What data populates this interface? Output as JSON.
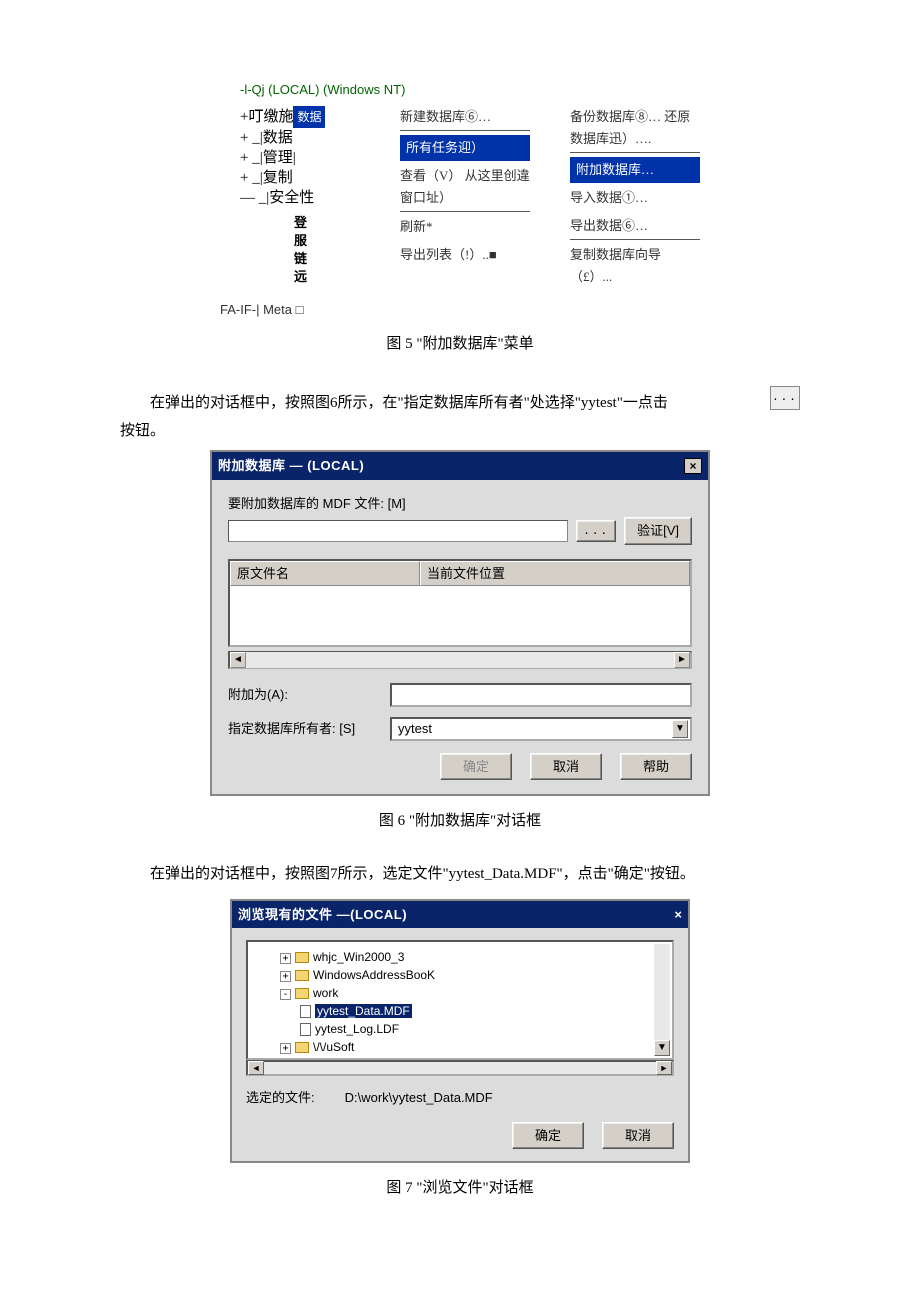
{
  "fig5": {
    "root": "-l-Qj (LOCAL) (Windows NT)",
    "tree": {
      "n1": "+叮缴施",
      "badge": "数据",
      "n2": "+ _|数据",
      "n3": "+ _|管理|",
      "n4": "+ _|复制",
      "n5": "— _|安全性",
      "i1": "登",
      "i2": "服",
      "i3": "链",
      "i4": "远"
    },
    "menu1": {
      "m1": "新建数据库⑥…",
      "m2": "所有任务迎）",
      "m3": "查看（V） 从这里创違窗口址）",
      "m4": "刷新*",
      "m5": "导出列表（!）..■"
    },
    "menu2": {
      "m1": "备份数据库⑧… 还原数据库迅）….",
      "m2": "附加数据库…",
      "m3": "导入数据①…",
      "m4": "导出数据⑥…",
      "m5": "复制数据库向导（£）..."
    },
    "meta": "FA-IF-| Meta □"
  },
  "caption5": "图 5 \"附加数据库\"菜单",
  "para6": "在弹出的对话框中，按照图6所示，在\"指定数据库所有者\"处选择\"yytest\"一点击",
  "para6b": "按钮。",
  "browse_dots": "...",
  "dlg6": {
    "title": "附加数据库 — (LOCAL)",
    "lbl_mdf": "要附加数据库的 MDF 文件: [M]",
    "btn_browse": "...",
    "btn_verify": "验证[V]",
    "th1": "原文件名",
    "th2": "当前文件位置",
    "lbl_attach_as": "附加为(A):",
    "lbl_owner": "指定数据库所有者: [S]",
    "owner_val": "yytest",
    "btn_ok": "确定",
    "btn_cancel": "取消",
    "btn_help": "帮助"
  },
  "caption6": "图 6 \"附加数据库\"对话框",
  "para7": "在弹出的对话框中，按照图7所示，选定文件\"yytest_Data.MDF\"，点击\"确定\"按钮。",
  "dlg7": {
    "title": "浏览現有的文件 —(LOCAL)",
    "node1": "whjc_Win2000_3",
    "node2": "WindowsAddressBooK",
    "node3": "work",
    "node4": "yytest_Data.MDF",
    "node5": "yytest_Log.LDF",
    "node6": "\\/\\/uSoft",
    "lbl_selected": "选定的文件:",
    "selected_val": "D:\\work\\yytest_Data.MDF",
    "btn_ok": "确定",
    "btn_cancel": "取消"
  },
  "caption7": "图 7 \"浏览文件\"对话框"
}
